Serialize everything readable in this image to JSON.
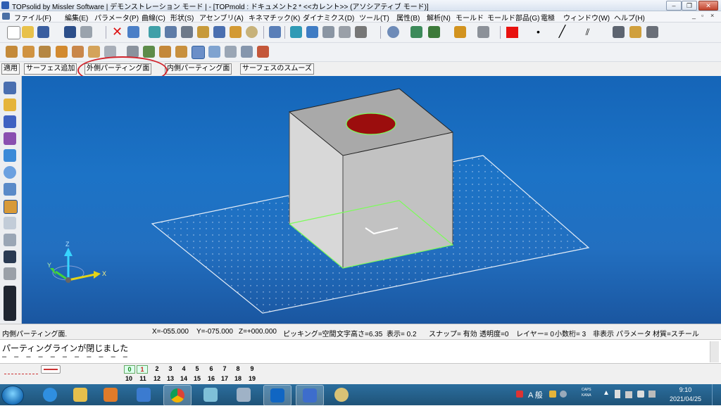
{
  "window": {
    "title": "TOPsolid by Missler Software | デモンストレーション モード | - [TOPmold : ドキュメント2 *  <<カレント>> (アソシアティブ モード)]",
    "min_label": "–",
    "max_label": "❐",
    "close_label": "✕",
    "mdi_min": "_",
    "mdi_restore": "▫",
    "mdi_close": "×"
  },
  "menu": [
    "ファイル(F)",
    "編集(E)",
    "パラメータ(P)",
    "曲線(C)",
    "形状(S)",
    "アセンブリ(A)",
    "キネマチック(K)",
    "ダイナミクス(D)",
    "ツール(T)",
    "属性(B)",
    "解析(N)",
    "モールド",
    "モールド部品(G)",
    "電極",
    "ウィンドウ(W)",
    "ヘルプ(H)"
  ],
  "command_bar": {
    "apply": "適用",
    "add_surface": "サーフェス追加",
    "outer_parting": "外側パーティング面",
    "inner_parting": "内側パーティング面",
    "smooth_surface": "サーフェスのスムーズ"
  },
  "viewport": {
    "axis_z": "Z",
    "axis_x": "X",
    "axis_y": "Y",
    "colors": {
      "background": "#1c6fc4",
      "block_top": "#a9a9a9",
      "block_front": "#d8d8d8",
      "block_side": "#c2c2c2",
      "hole": "#9b0d0d",
      "parting_edge": "#7cfc5a"
    }
  },
  "status": {
    "mode": "内側パーティング面.",
    "x": "X=-055.000",
    "y": "Y=-075.000",
    "z": "Z=+000.000",
    "picking": "ピッキング=空間",
    "text_height": "文字高さ=6.35",
    "display": "表示=  0.2",
    "snap": "スナップ= 有効",
    "transparency": "透明度=0",
    "layer": "レイヤー=  0",
    "decimals": "小数桁= 3",
    "hidden": "非表示",
    "parameter": "パラメータ",
    "material": "材質=スチール"
  },
  "message": {
    "text": "パーティングラインが閉じました",
    "dashes": "– – – – – – – – – – –"
  },
  "layers": {
    "row1": [
      "0",
      "1",
      "2",
      "3",
      "4",
      "5",
      "6",
      "7",
      "8",
      "9"
    ],
    "row2": [
      "10",
      "11",
      "12",
      "13",
      "14",
      "15",
      "16",
      "17",
      "18",
      "19"
    ]
  },
  "taskbar": {
    "ime_label": "A 般",
    "caps": "CAPS",
    "kana": "KANA",
    "time": "9:10",
    "date": "2021/04/25"
  }
}
